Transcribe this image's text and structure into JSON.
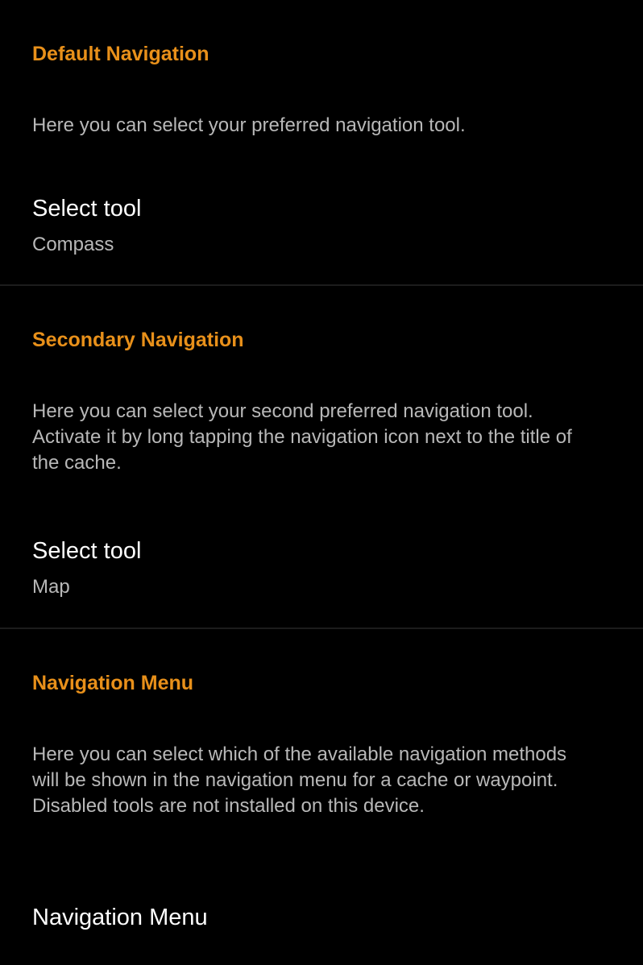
{
  "accent_color": "#e8901a",
  "sections": [
    {
      "header": "Default Navigation",
      "description": "Here you can select your preferred navigation tool.",
      "preference": {
        "title": "Select tool",
        "summary": "Compass"
      }
    },
    {
      "header": "Secondary Navigation",
      "description": "Here you can select your second preferred navigation tool. Activate it by long tapping the navigation icon next to the title of the cache.",
      "preference": {
        "title": "Select tool",
        "summary": "Map"
      }
    },
    {
      "header": "Navigation Menu",
      "description": "Here you can select which of the available navigation methods will be shown in the navigation menu for a cache or waypoint. Disabled tools are not installed on this device.",
      "preference": {
        "title": "Navigation Menu"
      }
    }
  ]
}
